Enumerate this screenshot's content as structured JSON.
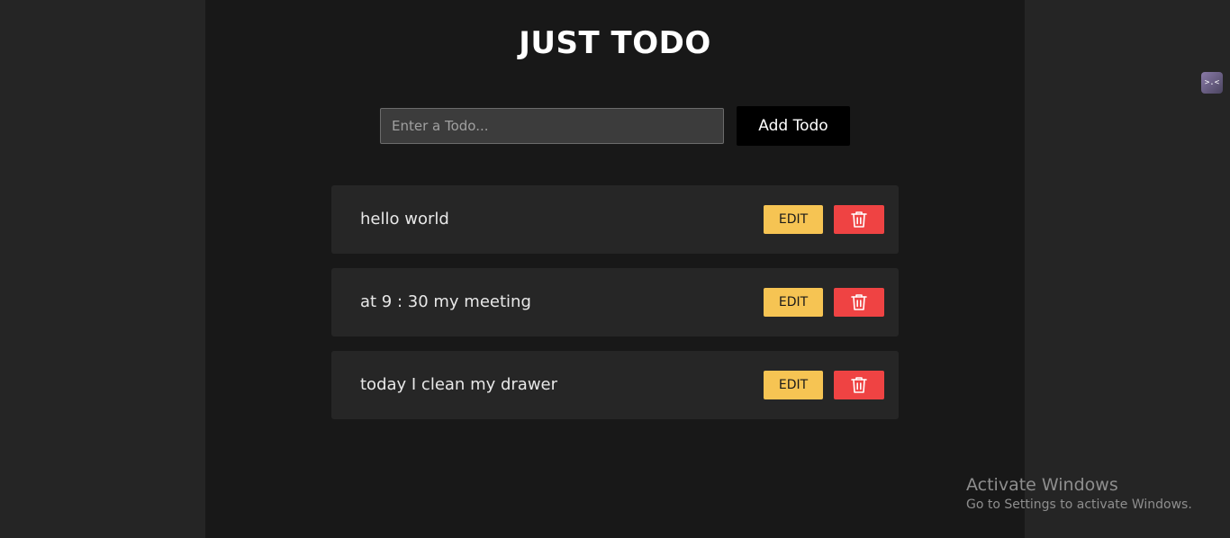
{
  "app": {
    "title": "JUST TODO"
  },
  "form": {
    "input_placeholder": "Enter a Todo...",
    "input_value": "",
    "add_label": "Add Todo"
  },
  "todos": [
    {
      "text": "hello world",
      "edit_label": "EDIT",
      "delete_icon": "trash-icon"
    },
    {
      "text": "at 9 : 30 my meeting",
      "edit_label": "EDIT",
      "delete_icon": "trash-icon"
    },
    {
      "text": "today I clean my drawer",
      "edit_label": "EDIT",
      "delete_icon": "trash-icon"
    }
  ],
  "extension": {
    "icon_text": ">.<"
  },
  "watermark": {
    "title": "Activate Windows",
    "subtitle": "Go to Settings to activate Windows."
  },
  "colors": {
    "page_background": "#252525",
    "app_background": "#181818",
    "item_background": "#262626",
    "edit_button": "#f6c453",
    "delete_button": "#ef4343",
    "add_button": "#000000"
  }
}
